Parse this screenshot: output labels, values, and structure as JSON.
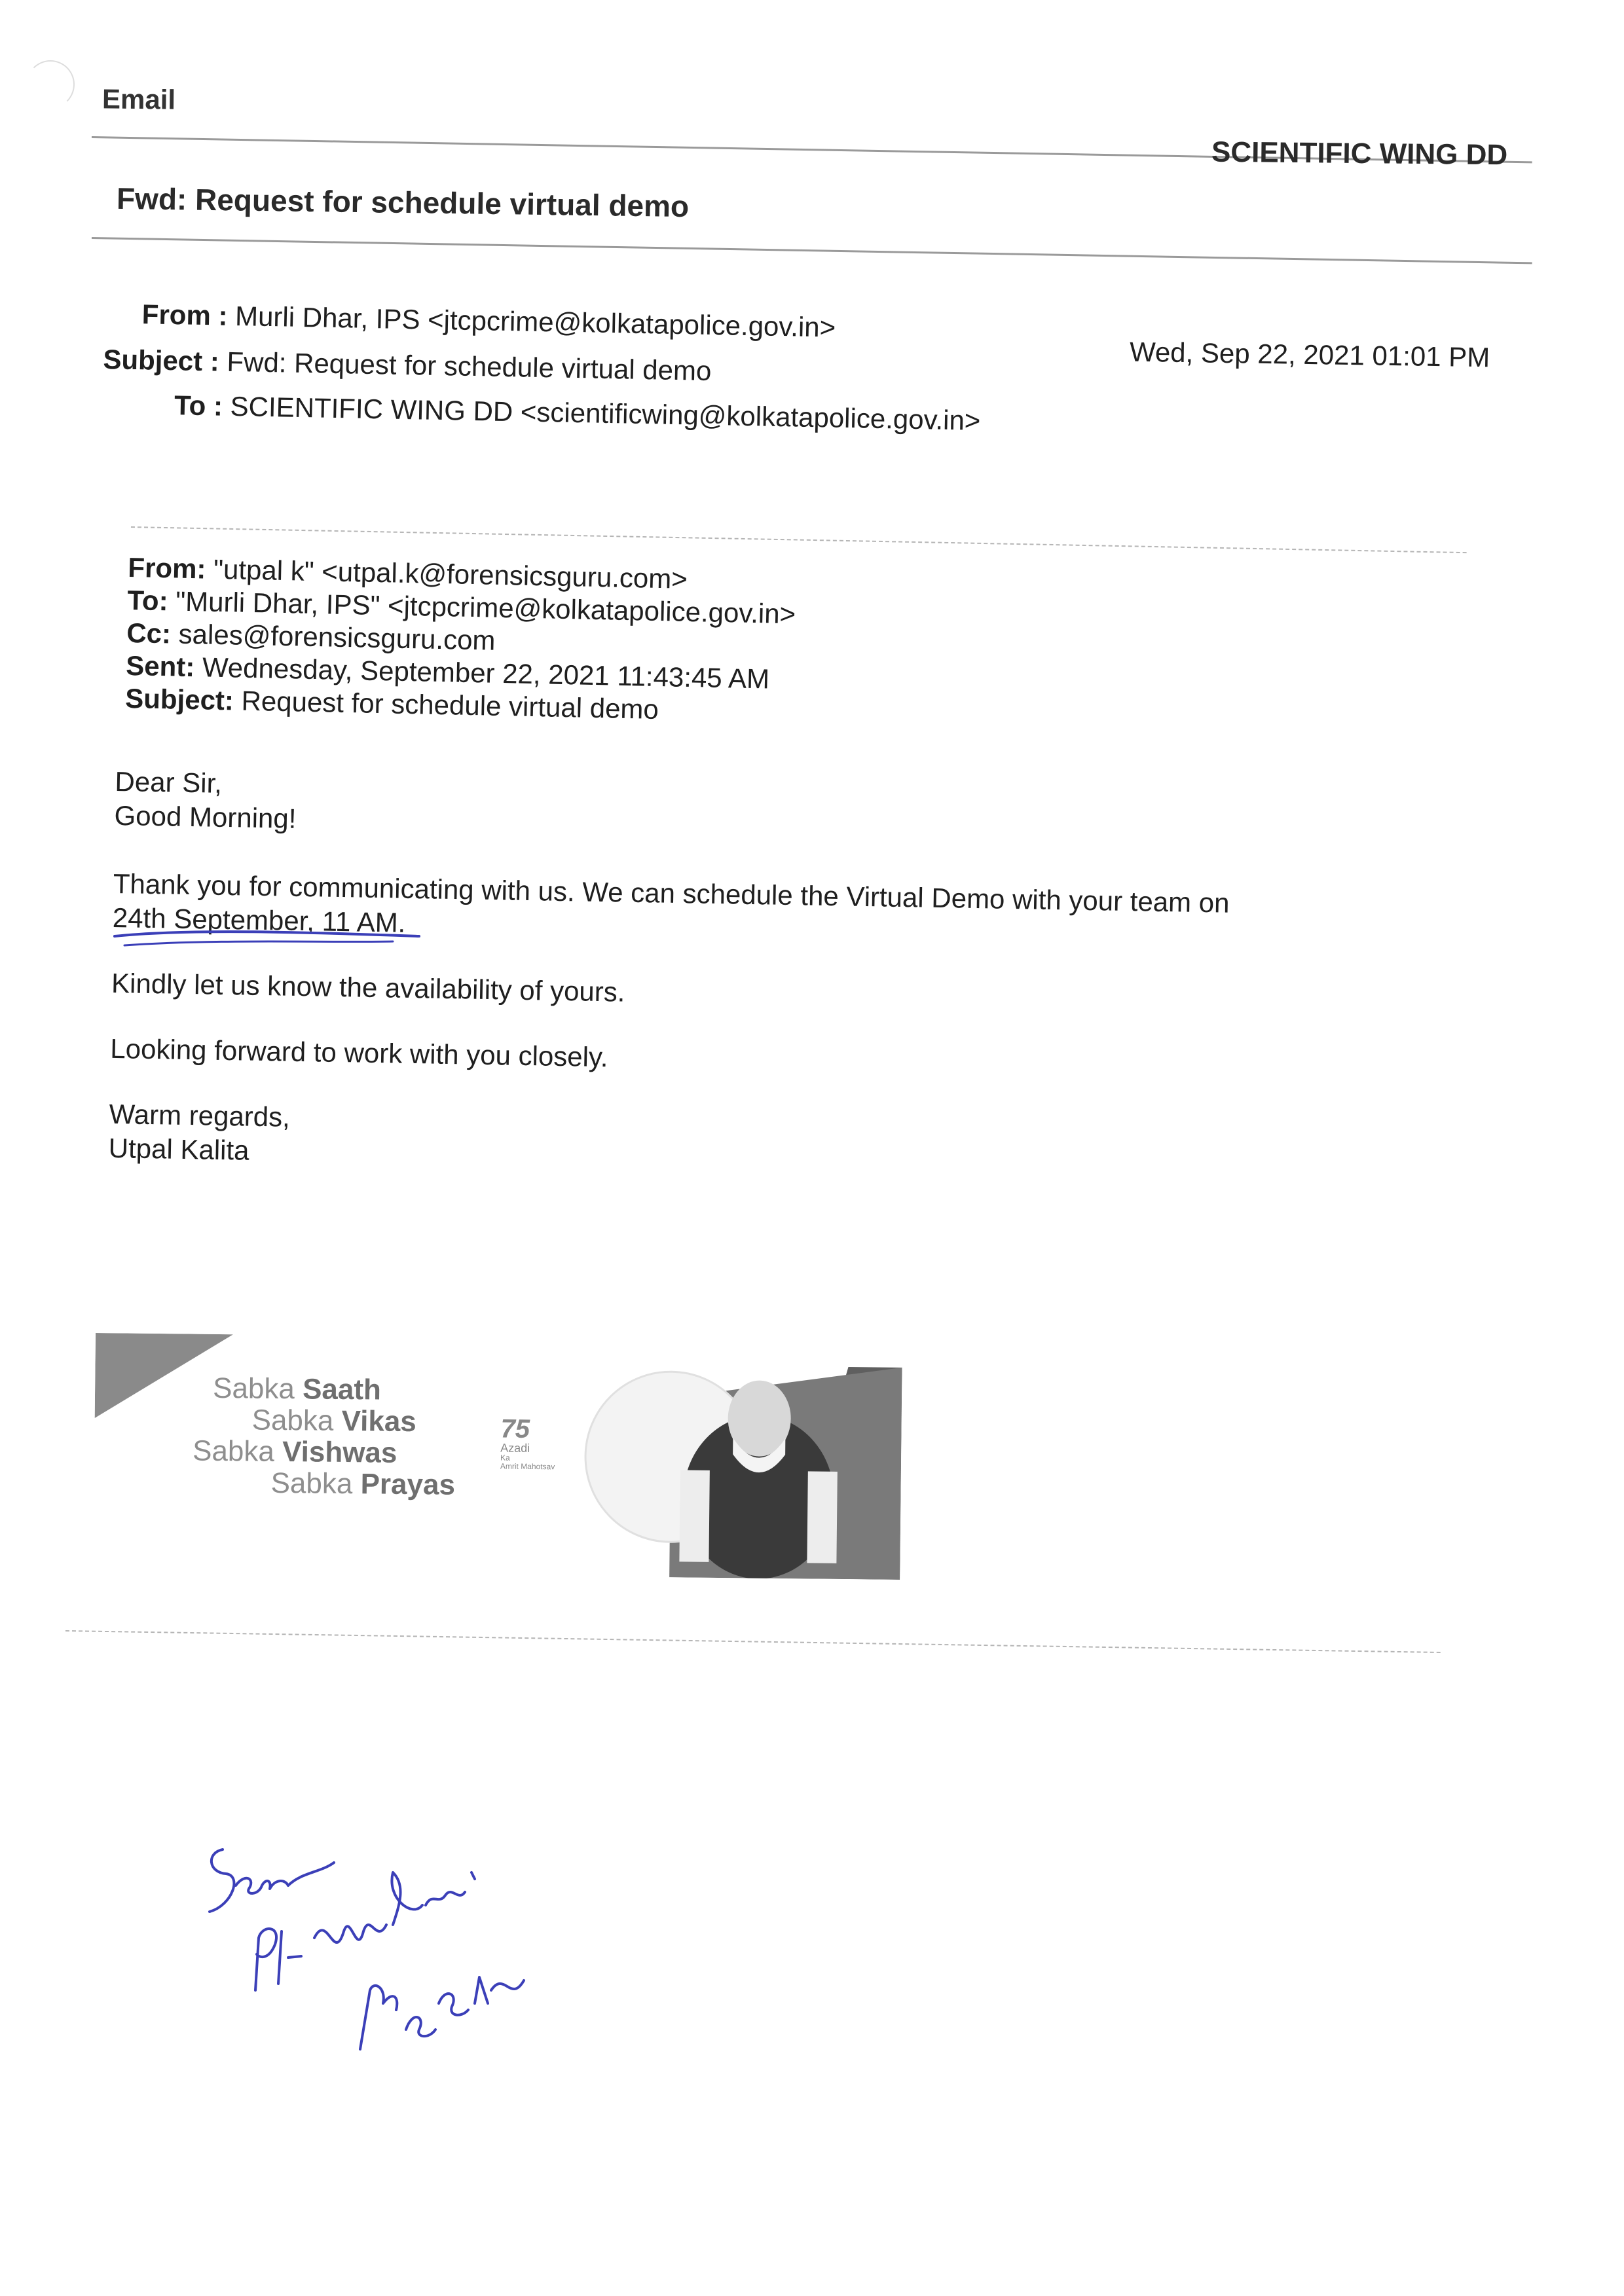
{
  "header": {
    "app_label": "Email",
    "account_name": "SCIENTIFIC WING DD",
    "message_title": "Fwd: Request for schedule virtual demo"
  },
  "forward": {
    "from_label": "From :",
    "from_value": "Murli Dhar, IPS <jtcpcrime@kolkatapolice.gov.in>",
    "subject_label": "Subject :",
    "subject_value": "Fwd: Request for schedule virtual demo",
    "to_label": "To :",
    "to_value": "SCIENTIFIC WING DD <scientificwing@kolkatapolice.gov.in>",
    "date": "Wed, Sep 22, 2021 01:01 PM"
  },
  "original": {
    "from_label": "From:",
    "from_value": "\"utpal k\" <utpal.k@forensicsguru.com>",
    "to_label": "To:",
    "to_value": "\"Murli Dhar, IPS\" <jtcpcrime@kolkatapolice.gov.in>",
    "cc_label": "Cc:",
    "cc_value": "sales@forensicsguru.com",
    "sent_label": "Sent:",
    "sent_value": "Wednesday, September 22, 2021 11:43:45 AM",
    "subject_label": "Subject:",
    "subject_value": "Request for schedule virtual demo"
  },
  "body": {
    "greeting_1": "Dear Sir,",
    "greeting_2": "Good Morning!",
    "para_1_line_1": "Thank you for communicating with us. We can schedule the Virtual Demo with your team on",
    "para_1_line_2": "24th September, 11 AM.",
    "para_2": "Kindly let us know the availability of yours.",
    "para_3": "Looking forward to work with you closely.",
    "closing": "Warm regards,",
    "signature_name": "Utpal Kalita"
  },
  "banner": {
    "line_1_light": "Sabka ",
    "line_1_bold": "Saath",
    "line_2_light": "Sabka ",
    "line_2_bold": "Vikas",
    "line_3_light": "Sabka ",
    "line_3_bold": "Vishwas",
    "line_4_light": "Sabka ",
    "line_4_bold": "Prayas",
    "logo_number": "75",
    "logo_text_1": "Azadi",
    "logo_text_2": "Ka",
    "logo_text_3": "Amrit Mahotsav"
  },
  "colors": {
    "ink_blue": "#3b3fb8",
    "rule_gray": "#9a9a9a",
    "banner_gray": "#8e8e8e"
  }
}
